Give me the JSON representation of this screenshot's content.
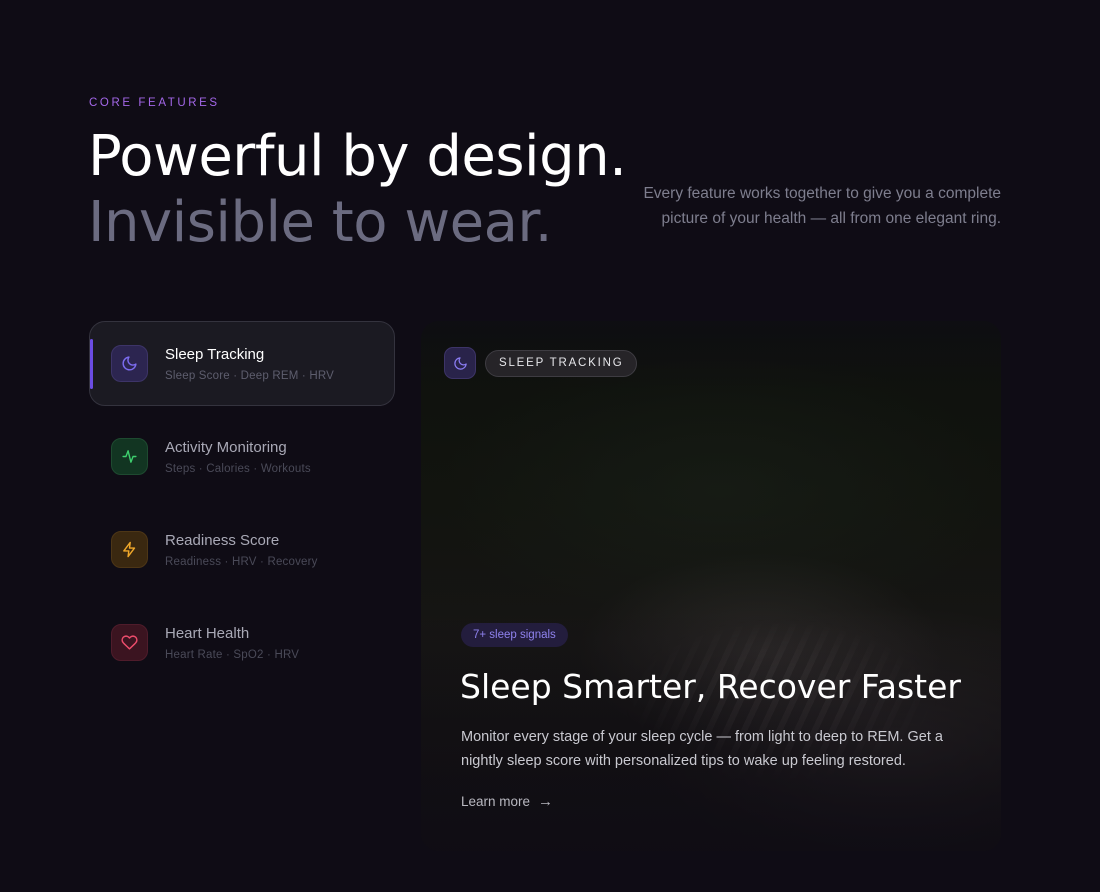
{
  "section": {
    "eyebrow": "CORE FEATURES",
    "headline_line1": "Powerful by design.",
    "headline_line2": "Invisible to wear.",
    "intro": "Every feature works together to give you a complete picture of your health — all from one elegant ring."
  },
  "features": [
    {
      "title": "Sleep Tracking",
      "subtitle": "Sleep Score · Deep REM · HRV",
      "icon": "moon-icon",
      "color": "#7c6cf0",
      "active": true
    },
    {
      "title": "Activity Monitoring",
      "subtitle": "Steps · Calories · Workouts",
      "icon": "activity-pulse-icon",
      "color": "#3ecf6e",
      "active": false
    },
    {
      "title": "Readiness Score",
      "subtitle": "Readiness · HRV · Recovery",
      "icon": "lightning-bolt-icon",
      "color": "#f0a82a",
      "active": false
    },
    {
      "title": "Heart Health",
      "subtitle": "Heart Rate · SpO2 · HRV",
      "icon": "heart-icon",
      "color": "#ee4d6c",
      "active": false
    }
  ],
  "detail": {
    "tag": "SLEEP TRACKING",
    "icon": "moon-icon",
    "badge": "7+ sleep signals",
    "title": "Sleep Smarter, Recover Faster",
    "description": "Monitor every stage of your sleep cycle — from light to deep to REM. Get a nightly sleep score with personalized tips to wake up feeling restored.",
    "link_label": "Learn more",
    "link_arrow": "→"
  },
  "colors": {
    "background": "#0f0c15",
    "accent": "#a367e8",
    "active_bar": "#6b4ce3"
  }
}
